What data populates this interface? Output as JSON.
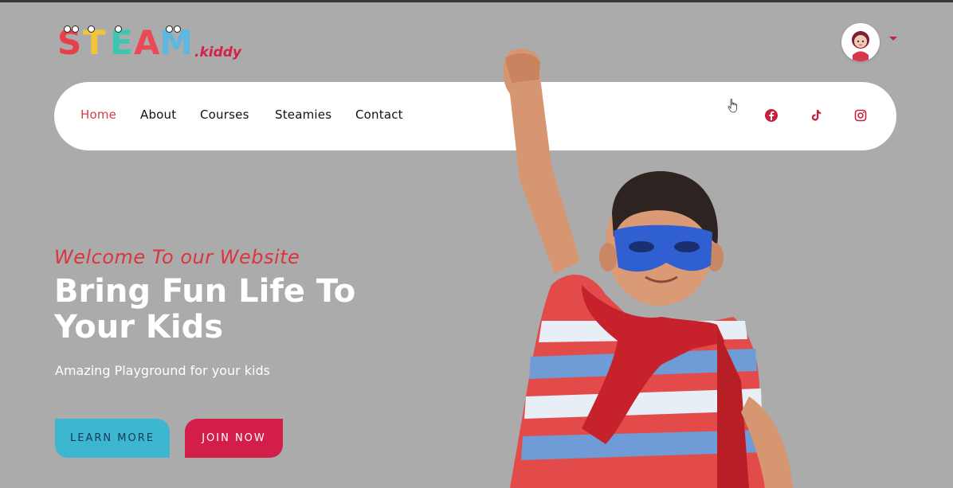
{
  "logo": {
    "letters": [
      "S",
      "T",
      "E",
      "A",
      "M"
    ],
    "tld": ".kiddy",
    "colors": [
      "#e8404a",
      "#f2c438",
      "#3dc6b0",
      "#e94a57",
      "#5db7e0"
    ]
  },
  "nav": {
    "items": [
      "Home",
      "About",
      "Courses",
      "Steamies",
      "Contact"
    ],
    "active": "Home",
    "social_icons": [
      "facebook-icon",
      "tiktok-icon",
      "instagram-icon"
    ]
  },
  "hero": {
    "welcome": "Welcome To our Website",
    "title": "Bring Fun Life To Your Kids",
    "subtitle": "Amazing Playground for your kids",
    "learn_more": "LEARN MORE",
    "join_now": "JOIN NOW"
  },
  "colors": {
    "background": "#ababab",
    "accent_red": "#d41e4a",
    "accent_cyan": "#3db7d0"
  }
}
